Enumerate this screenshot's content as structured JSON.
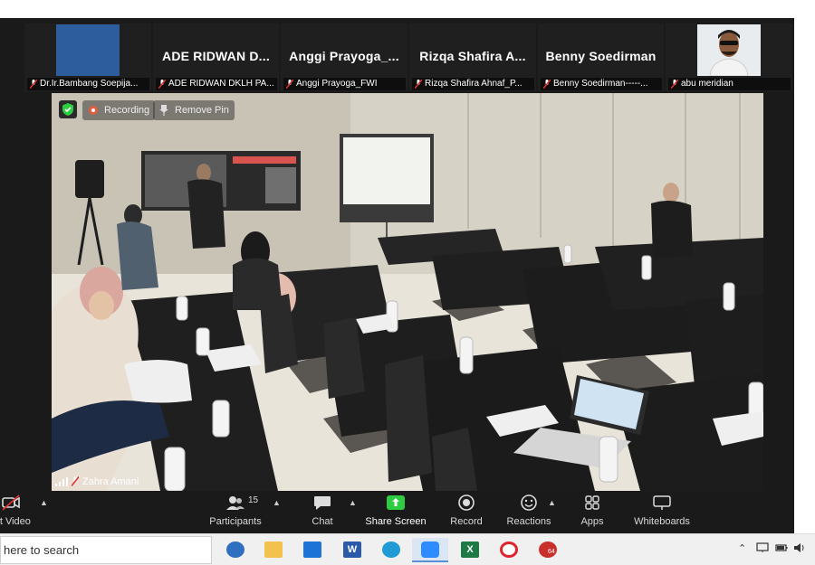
{
  "meeting": {
    "thumbnails": [
      {
        "display": "",
        "caption": "Dr.Ir.Bambang Soepija...",
        "muted": true,
        "kind": "blue"
      },
      {
        "display": "ADE RIDWAN D...",
        "caption": "ADE RIDWAN DKLH PA...",
        "muted": true,
        "kind": "name"
      },
      {
        "display": "Anggi Prayoga_...",
        "caption": "Anggi Prayoga_FWI",
        "muted": true,
        "kind": "name"
      },
      {
        "display": "Rizqa Shafira A...",
        "caption": "Rizqa Shafira Ahnaf_P...",
        "muted": true,
        "kind": "name"
      },
      {
        "display": "Benny Soedirman",
        "caption": "Benny Soedirman-----...",
        "muted": true,
        "kind": "name"
      },
      {
        "display": "",
        "caption": "abu meridian",
        "muted": true,
        "kind": "photo"
      }
    ],
    "main_video": {
      "recording_label": "Recording",
      "remove_pin_label": "Remove Pin",
      "speaker_name": "Zahra Amani"
    }
  },
  "toolbar": {
    "start_video": "art Video",
    "participants": "Participants",
    "participants_count": "15",
    "chat": "Chat",
    "share_screen": "Share Screen",
    "record": "Record",
    "reactions": "Reactions",
    "apps": "Apps",
    "whiteboards": "Whiteboards"
  },
  "taskbar": {
    "search_placeholder": "here to search",
    "apps": [
      "edge-beta-icon",
      "file-explorer-icon",
      "mail-icon",
      "word-icon",
      "edge-icon",
      "zoom-icon",
      "excel-icon",
      "opera-icon",
      "app-badge-icon"
    ],
    "badge_count": "64"
  },
  "colors": {
    "zoom_bg": "#1a1a1a",
    "accent_blue": "#2d8cff",
    "share_green": "#2ecc40",
    "mute_red": "#e02f2f"
  }
}
